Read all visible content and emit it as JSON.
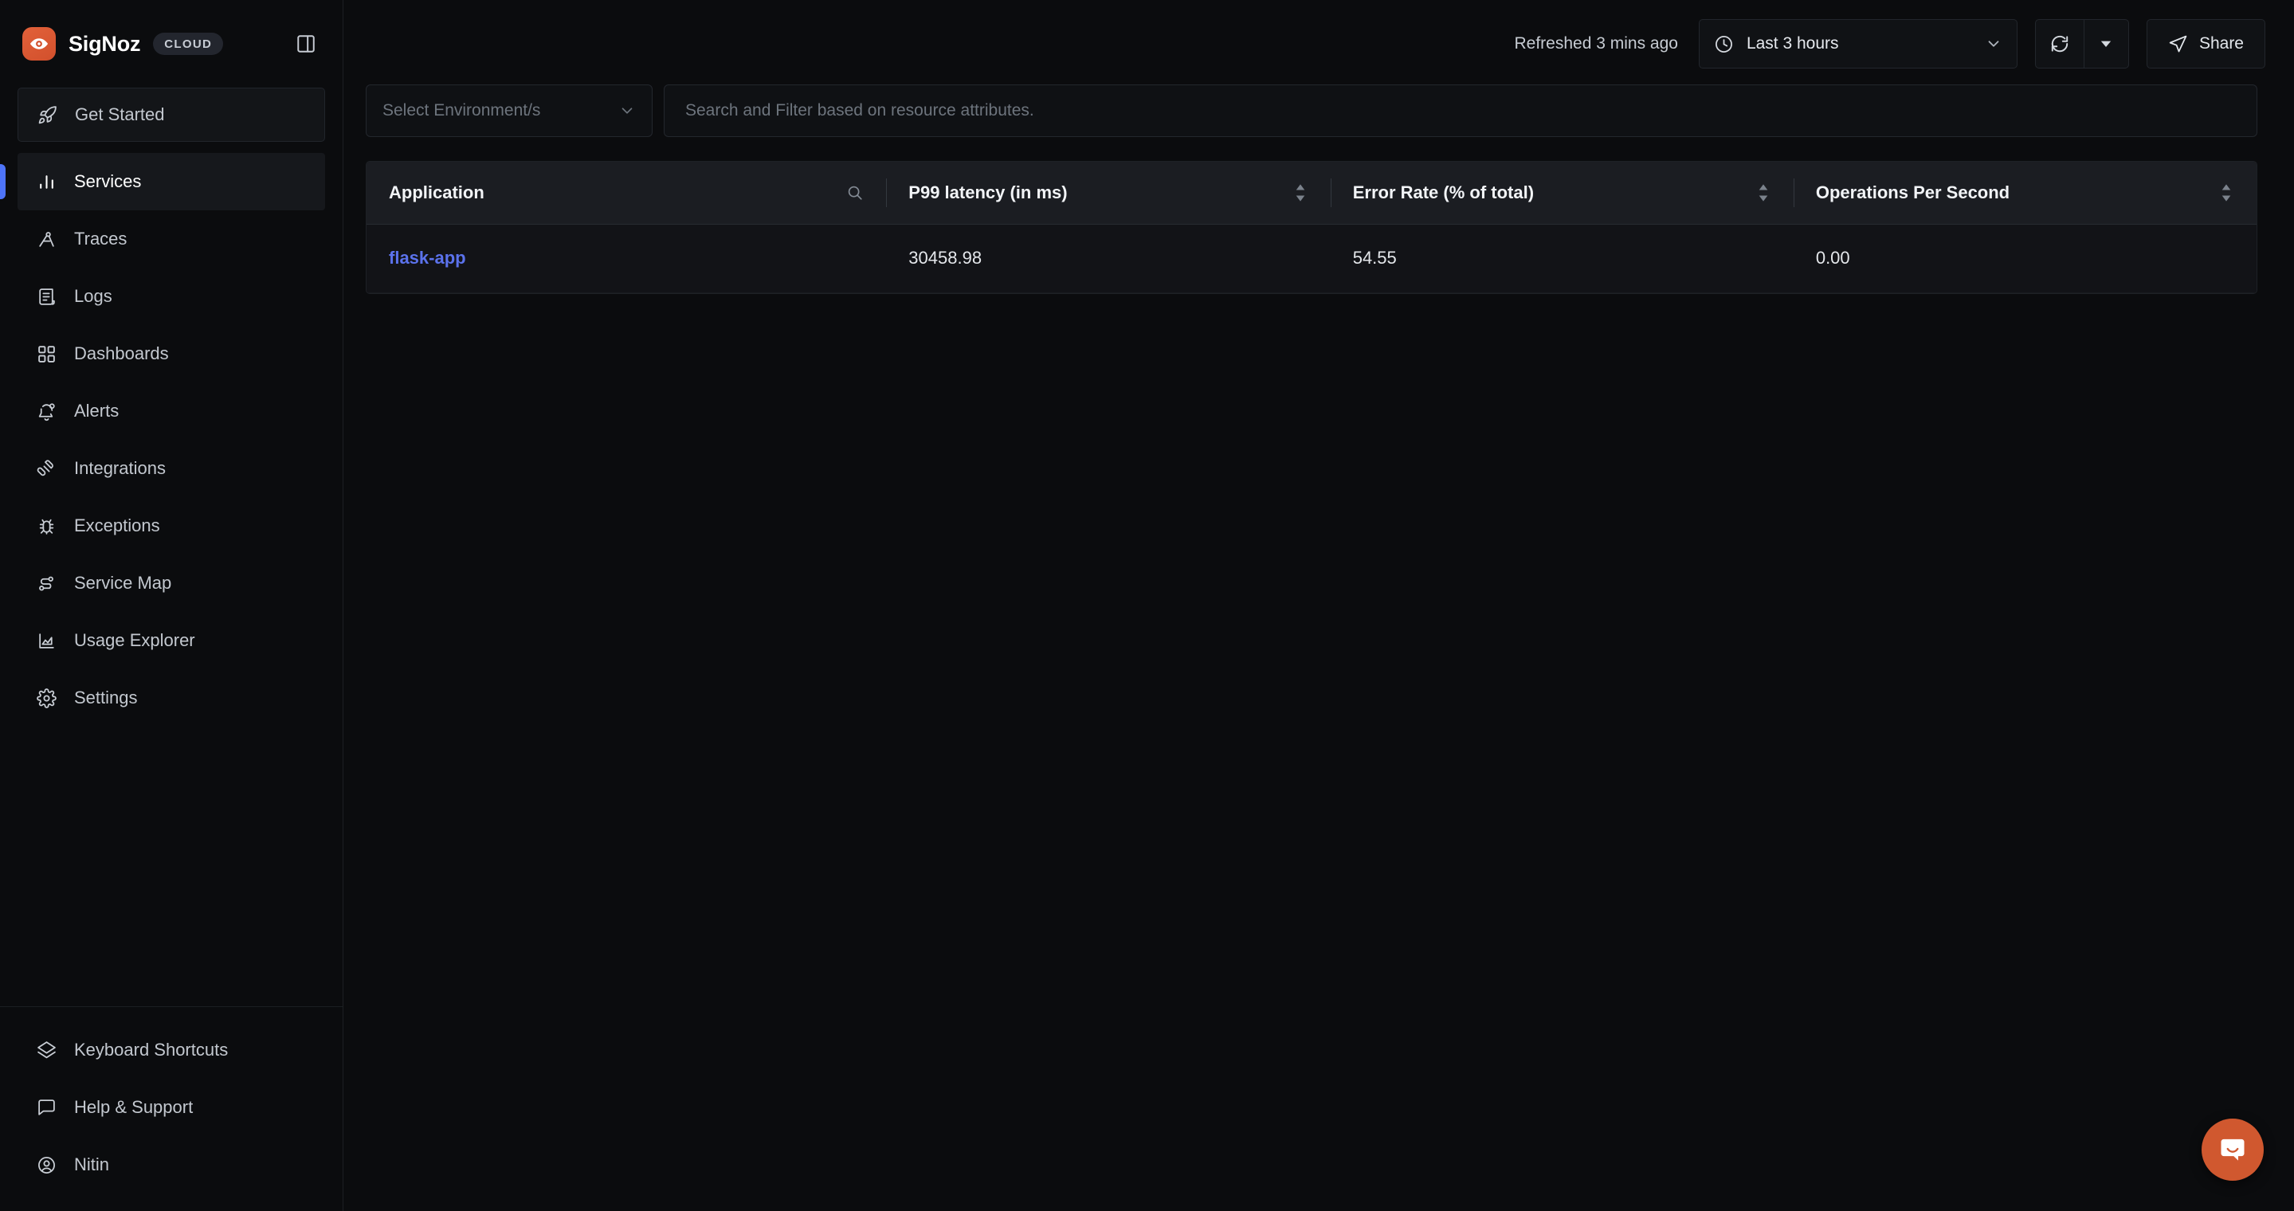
{
  "brand": {
    "name": "SigNoz",
    "badge": "CLOUD",
    "logo_color": "#d2502c"
  },
  "sidebar": {
    "primary_items": [
      {
        "label": "Get Started",
        "icon": "rocket-icon",
        "style": "boxed"
      },
      {
        "label": "Services",
        "icon": "bar-chart-icon",
        "style": "active"
      },
      {
        "label": "Traces",
        "icon": "traces-icon",
        "style": "normal"
      },
      {
        "label": "Logs",
        "icon": "logs-icon",
        "style": "normal"
      },
      {
        "label": "Dashboards",
        "icon": "grid-icon",
        "style": "normal"
      },
      {
        "label": "Alerts",
        "icon": "bell-icon",
        "style": "normal"
      },
      {
        "label": "Integrations",
        "icon": "plug-icon",
        "style": "normal"
      },
      {
        "label": "Exceptions",
        "icon": "bug-icon",
        "style": "normal"
      },
      {
        "label": "Service Map",
        "icon": "service-map-icon",
        "style": "normal"
      },
      {
        "label": "Usage Explorer",
        "icon": "area-chart-icon",
        "style": "normal"
      },
      {
        "label": "Settings",
        "icon": "gear-icon",
        "style": "normal"
      }
    ],
    "bottom_items": [
      {
        "label": "Keyboard Shortcuts",
        "icon": "layers-icon"
      },
      {
        "label": "Help & Support",
        "icon": "chat-icon"
      },
      {
        "label": "Nitin",
        "icon": "user-circle-icon"
      }
    ],
    "active_indicator_color": "#4e74f8"
  },
  "topbar": {
    "refreshed_label": "Refreshed 3 mins ago",
    "time_range": "Last 3 hours",
    "time_icon": "clock-icon",
    "chevron_icon": "chevron-down-icon",
    "refresh_icon": "refresh-icon",
    "refresh_dropdown_icon": "caret-down-icon",
    "share_label": "Share",
    "share_icon": "send-icon"
  },
  "filters": {
    "environment_placeholder": "Select Environment/s",
    "environment_value": "",
    "environment_chevron_icon": "chevron-down-icon",
    "search_placeholder": "Search and Filter based on resource attributes.",
    "search_value": ""
  },
  "table": {
    "columns": [
      {
        "label": "Application",
        "tool": "search-icon"
      },
      {
        "label": "P99 latency (in ms)",
        "tool": "sort-icon"
      },
      {
        "label": "Error Rate (% of total)",
        "tool": "sort-icon"
      },
      {
        "label": "Operations Per Second",
        "tool": "sort-icon"
      }
    ],
    "rows": [
      {
        "application": "flask-app",
        "p99_latency": "30458.98",
        "error_rate": "54.55",
        "ops_per_second": "0.00"
      }
    ]
  },
  "support": {
    "intercom_icon": "intercom-chat-icon",
    "intercom_color": "#d0582f"
  }
}
